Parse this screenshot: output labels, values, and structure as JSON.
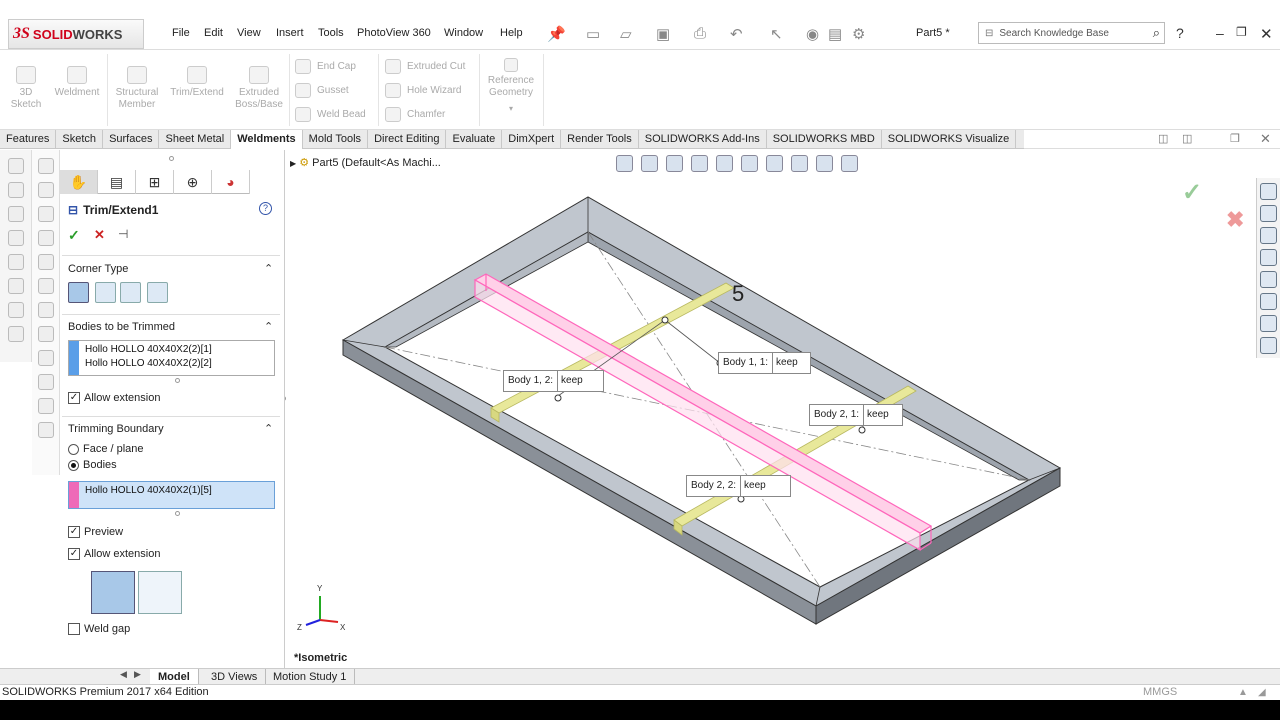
{
  "app": {
    "name": "SOLIDWORKS",
    "doc_title": "Part5 *"
  },
  "menu": [
    "File",
    "Edit",
    "View",
    "Insert",
    "Tools",
    "PhotoView 360",
    "Window",
    "Help"
  ],
  "search": {
    "placeholder": "Search Knowledge Base"
  },
  "ribbon": {
    "large": [
      {
        "label": "3D\nSketch"
      },
      {
        "label": "Weldment"
      },
      {
        "label": "Structural\nMember"
      },
      {
        "label": "Trim/Extend"
      },
      {
        "label": "Extruded\nBoss/Base"
      }
    ],
    "small_col1": [
      "End Cap",
      "Gusset",
      "Weld Bead"
    ],
    "small_col2": [
      "Extruded Cut",
      "Hole Wizard",
      "Chamfer"
    ],
    "reference": "Reference\nGeometry"
  },
  "tabs": [
    "Features",
    "Sketch",
    "Surfaces",
    "Sheet Metal",
    "Weldments",
    "Mold Tools",
    "Direct Editing",
    "Evaluate",
    "DimXpert",
    "Render Tools",
    "SOLIDWORKS Add-Ins",
    "SOLIDWORKS MBD",
    "SOLIDWORKS Visualize"
  ],
  "active_tab": "Weldments",
  "property_manager": {
    "title": "Trim/Extend1",
    "corner_type": "Corner Type",
    "bodies_trimmed": {
      "label": "Bodies to be Trimmed",
      "items": [
        "Hollo HOLLO 40X40X2(2)[1]",
        "Hollo HOLLO 40X40X2(2)[2]"
      ],
      "allow_extension": "Allow extension"
    },
    "trimming_boundary": {
      "label": "Trimming Boundary",
      "face_plane": "Face / plane",
      "bodies": "Bodies",
      "selected_option": "Bodies",
      "items": [
        "Hollo HOLLO 40X40X2(1)[5]"
      ],
      "preview": "Preview",
      "allow_extension": "Allow extension",
      "weld_gap": "Weld gap"
    }
  },
  "tree": {
    "part": "Part5",
    "config": "(Default<As Machi..."
  },
  "callouts": [
    {
      "label": "Body  1,  2:",
      "value": "keep"
    },
    {
      "label": "Body  1,   1:",
      "value": "keep"
    },
    {
      "label": "Body  2,   1:",
      "value": "keep"
    },
    {
      "label": "Body  2,   2:",
      "value": "keep"
    }
  ],
  "triad": {
    "x": "X",
    "y": "Y",
    "z": "Z"
  },
  "view_name": "*Isometric",
  "annotation_number": "5",
  "bottom_tabs": [
    "Model",
    "3D Views",
    "Motion Study 1"
  ],
  "status": {
    "left": "SOLIDWORKS Premium 2017 x64 Edition",
    "units": "MMGS"
  },
  "colors": {
    "accent_red": "#d0021b",
    "selection_pink": "#ff88cc",
    "preview_yellow": "#e8e89a",
    "frame_gray": "#9aa0a8"
  }
}
